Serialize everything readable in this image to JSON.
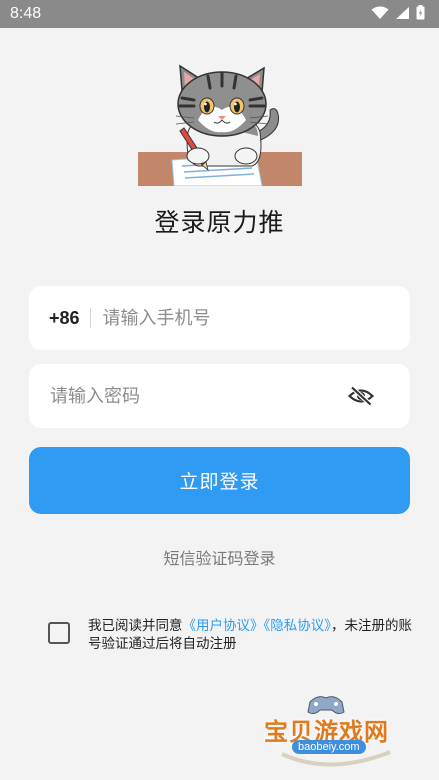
{
  "status_bar": {
    "time": "8:48"
  },
  "app": {
    "title": "登录原力推"
  },
  "phone_field": {
    "country_code": "+86",
    "placeholder": "请输入手机号"
  },
  "password_field": {
    "placeholder": "请输入密码"
  },
  "login_button": {
    "label": "立即登录"
  },
  "sms_login": {
    "label": "短信验证码登录"
  },
  "agreement": {
    "prefix": "我已阅读并同意",
    "user_agreement": "《用户协议》",
    "privacy_agreement": "《隐私协议》",
    "suffix": "，未注册的账号验证通过后将自动注册",
    "checked": false
  },
  "watermark": {
    "text": "宝贝游戏网",
    "url": "baobeiy.com"
  },
  "colors": {
    "accent": "#2f9bf2",
    "background": "#f3f3f4",
    "status_bar": "#8a8a8a"
  },
  "icons": {
    "wifi": "wifi-icon",
    "signal": "signal-icon",
    "battery": "battery-icon",
    "password_toggle": "eye-off-icon",
    "logo": "cat-writing-logo"
  }
}
